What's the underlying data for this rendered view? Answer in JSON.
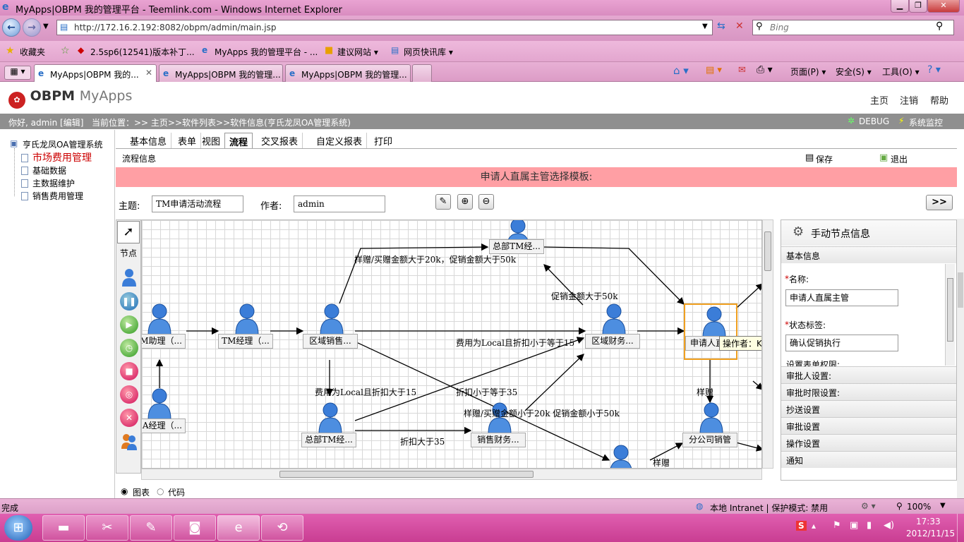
{
  "window": {
    "title": "MyApps|OBPM 我的管理平台 - Teemlink.com - Windows Internet Explorer"
  },
  "browser": {
    "url": "http://172.16.2.192:8082/obpm/admin/main.jsp",
    "search_placeholder": "Bing",
    "favorites": [
      "收藏夹",
      "2.5sp6(12541)版本补丁...",
      "MyApps 我的管理平台 - ...",
      "建议网站 ▾",
      "网页快讯库 ▾"
    ],
    "tabs": [
      "MyApps|OBPM 我的...",
      "MyApps|OBPM 我的管理...",
      "MyApps|OBPM 我的管理..."
    ],
    "commands": [
      "页面(P) ▾",
      "安全(S) ▾",
      "工具(O) ▾"
    ]
  },
  "app": {
    "logo": "OBPM",
    "logo_sub": "MyApps",
    "top_links": [
      "主页",
      "注销",
      "帮助"
    ],
    "greeting": "你好, admin [编辑]",
    "location": "当前位置：>> 主页>>软件列表>>软件信息(亨氏龙凤OA管理系统)",
    "debug": "DEBUG",
    "monitor": "系统监控",
    "tree": {
      "root": "亨氏龙凤OA管理系统",
      "items": [
        "市场费用管理",
        "基础数据",
        "主数据维护",
        "销售费用管理"
      ]
    },
    "tabs": [
      "基本信息",
      "表单",
      "视图",
      "流程",
      "交叉报表",
      "自定义报表",
      "打印"
    ],
    "active_tab": "流程",
    "section_title": "流程信息",
    "save": "保存",
    "exit": "退出",
    "banner": "申请人直属主管选择模板:",
    "subject_label": "主题:",
    "subject_value": "TM申请活动流程",
    "author_label": "作者:",
    "author_value": "admin",
    "palette_label": "节点",
    "view_options": [
      "图表",
      "代码"
    ],
    "selected_view": "图表"
  },
  "flow": {
    "nodes": [
      {
        "label": "M助理（..."
      },
      {
        "label": "TM经理（..."
      },
      {
        "label": "区域销售..."
      },
      {
        "label": "总部TM经..."
      },
      {
        "label": "区域财务..."
      },
      {
        "label": "申请人直"
      },
      {
        "label": "A经理（..."
      },
      {
        "label": "总部TM经..."
      },
      {
        "label": "销售财务..."
      },
      {
        "label": "分公司销管"
      }
    ],
    "edge_labels": [
      "样赠/买赠金额大于20k，促销金额大于50k",
      "促销金额大于50k",
      "费用为Local且折扣小于等于15",
      "费用为Local且折扣大于15",
      "折扣小于等于35",
      "样赠/买赠金额小于20k 促销金额小于50k",
      "折扣大于35",
      "样赠",
      "样赠"
    ],
    "tooltip": "操作者：KA经理"
  },
  "panel": {
    "title": "手动节点信息",
    "basic": "基本信息",
    "name_label": "名称:",
    "name_value": "申请人直属主管",
    "state_label": "状态标签:",
    "state_value": "确认促销执行",
    "form_perm": "设置表单权限:",
    "sections": [
      "审批人设置:",
      "审批时限设置:",
      "抄送设置",
      "审批设置",
      "操作设置",
      "通知"
    ]
  },
  "status": {
    "left": "完成",
    "zone": "本地 Intranet | 保护模式: 禁用",
    "zoom": "100%"
  },
  "taskbar": {
    "time": "17:33",
    "date": "2012/11/15"
  }
}
